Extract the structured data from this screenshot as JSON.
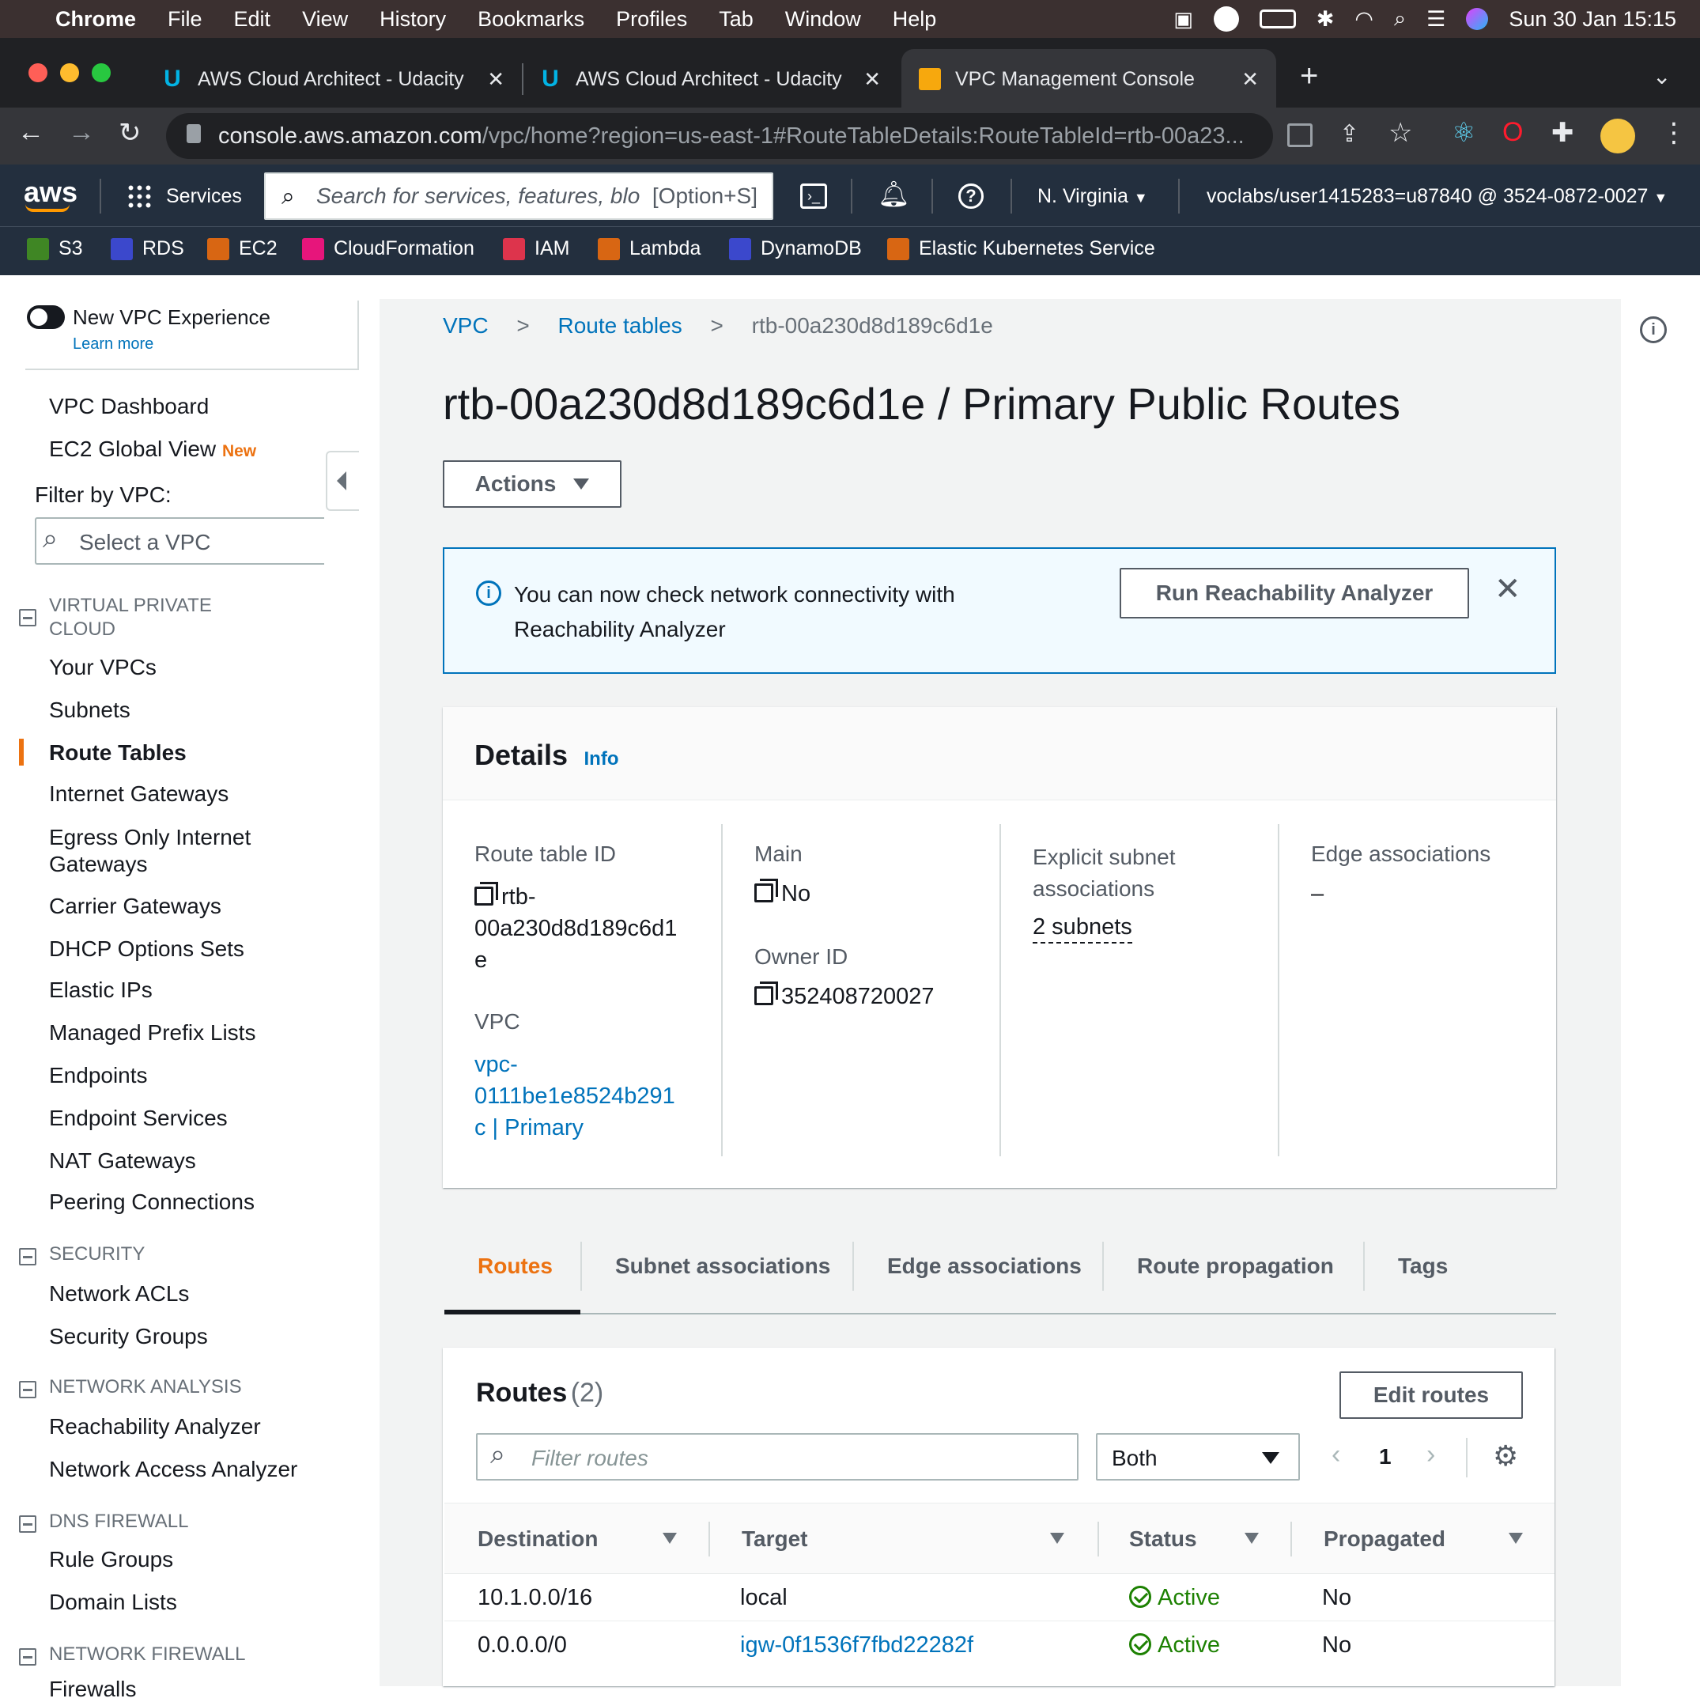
{
  "menubar": {
    "app": "Chrome",
    "items": [
      "File",
      "Edit",
      "View",
      "History",
      "Bookmarks",
      "Profiles",
      "Tab",
      "Window",
      "Help"
    ],
    "datetime": "Sun 30 Jan  15:15"
  },
  "tabs": [
    {
      "title": "AWS Cloud Architect - Udacity"
    },
    {
      "title": "AWS Cloud Architect - Udacity"
    },
    {
      "title": "VPC Management Console"
    }
  ],
  "address": {
    "host": "console.aws.amazon.com",
    "path": "/vpc/home?region=us-east-1#RouteTableDetails:RouteTableId=rtb-00a23..."
  },
  "aws_nav": {
    "logo": "aws",
    "services": "Services",
    "search_placeholder": "Search for services, features, blo",
    "search_shortcut": "[Option+S]",
    "region": "N. Virginia",
    "account": "voclabs/user1415283=u87840 @ 3524-0872-0027",
    "favorites": [
      "S3",
      "RDS",
      "EC2",
      "CloudFormation",
      "IAM",
      "Lambda",
      "DynamoDB",
      "Elastic Kubernetes Service"
    ],
    "favorite_colors": [
      "#3f8624",
      "#3b48cc",
      "#d86613",
      "#e7157b",
      "#dd344c",
      "#d86613",
      "#3b48cc",
      "#d86613"
    ]
  },
  "sidebar": {
    "toggle_label": "New VPC Experience",
    "learn_more": "Learn more",
    "dashboard": "VPC Dashboard",
    "ec2_global": "EC2 Global View",
    "new_badge": "New",
    "filter_label": "Filter by VPC:",
    "filter_placeholder": "Select a VPC",
    "sec_vpc_line1": "VIRTUAL PRIVATE",
    "sec_vpc_line2": "CLOUD",
    "your_vpcs": "Your VPCs",
    "subnets": "Subnets",
    "route_tables": "Route Tables",
    "internet_gateways": "Internet Gateways",
    "egress_line1": "Egress Only Internet",
    "egress_line2": "Gateways",
    "carrier": "Carrier Gateways",
    "dhcp": "DHCP Options Sets",
    "elastic_ips": "Elastic IPs",
    "prefix_lists": "Managed Prefix Lists",
    "endpoints": "Endpoints",
    "endpoint_services": "Endpoint Services",
    "nat": "NAT Gateways",
    "peering": "Peering Connections",
    "sec_security": "SECURITY",
    "nacls": "Network ACLs",
    "security_groups": "Security Groups",
    "sec_network_analysis": "NETWORK ANALYSIS",
    "reachability": "Reachability Analyzer",
    "network_access": "Network Access Analyzer",
    "sec_dns": "DNS FIREWALL",
    "rule_groups": "Rule Groups",
    "domain_lists": "Domain Lists",
    "sec_network_firewall": "NETWORK FIREWALL",
    "firewalls": "Firewalls"
  },
  "breadcrumb": {
    "vpc": "VPC",
    "route_tables": "Route tables",
    "current": "rtb-00a230d8d189c6d1e"
  },
  "page_title": "rtb-00a230d8d189c6d1e / Primary Public Routes",
  "actions_label": "Actions",
  "banner": {
    "line1": "You can now check network connectivity with",
    "line2": "Reachability Analyzer",
    "button": "Run Reachability Analyzer"
  },
  "details": {
    "title": "Details",
    "info": "Info",
    "route_table_id_label": "Route table ID",
    "route_table_id_l1": "rtb-",
    "route_table_id_l2": "00a230d8d189c6d1",
    "route_table_id_l3": "e",
    "vpc_label": "VPC",
    "vpc_l1": "vpc-",
    "vpc_l2": "0111be1e8524b291",
    "vpc_l3": "c | Primary",
    "main_label": "Main",
    "main_value": "No",
    "owner_label": "Owner ID",
    "owner_value": "352408720027",
    "explicit_l1": "Explicit subnet",
    "explicit_l2": "associations",
    "explicit_value": "2 subnets",
    "edge_label": "Edge associations",
    "edge_value": "–"
  },
  "detail_tabs": [
    "Routes",
    "Subnet associations",
    "Edge associations",
    "Route propagation",
    "Tags"
  ],
  "routes": {
    "title": "Routes",
    "count": "(2)",
    "edit_button": "Edit routes",
    "filter_placeholder": "Filter routes",
    "select_value": "Both",
    "page": "1",
    "columns": [
      "Destination",
      "Target",
      "Status",
      "Propagated"
    ],
    "rows": [
      {
        "destination": "10.1.0.0/16",
        "target": "local",
        "status": "Active",
        "propagated": "No"
      },
      {
        "destination": "0.0.0.0/0",
        "target": "igw-0f1536f7fbd22282f",
        "status": "Active",
        "propagated": "No"
      }
    ]
  }
}
